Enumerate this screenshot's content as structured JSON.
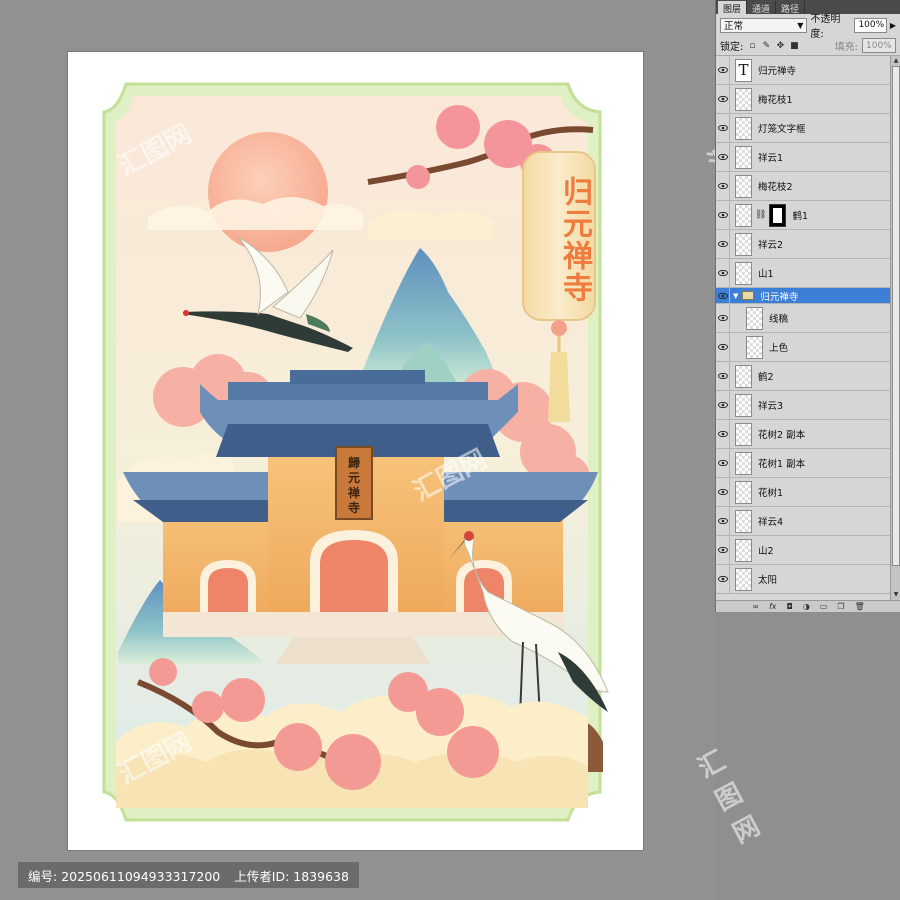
{
  "artwork": {
    "vertical_title": "归元禅寺",
    "gate_plaque": "歸元禅寺",
    "colors": {
      "frame": "#c9e3a3",
      "sky": "#f8ecd5",
      "sun": "#f7b79e",
      "mountain": "#6f9fc2",
      "roof": "#5b7ea8",
      "wall": "#f2b568",
      "door": "#ee7f63",
      "blossom": "#f48f8a",
      "lantern": "#f9e5b2",
      "title_text": "#ef7c3f"
    }
  },
  "watermark": {
    "text": "汇图网"
  },
  "info_bar": {
    "id_label": "编号:",
    "id_value": "20250611094933317200",
    "uploader_label": "上传者ID:",
    "uploader_value": "1839638"
  },
  "layers_panel": {
    "tabs": [
      "图层",
      "通道",
      "路径"
    ],
    "blend_mode": "正常",
    "opacity_label": "不透明度:",
    "opacity_value": "100%",
    "lock_label": "锁定:",
    "fill_label": "填充:",
    "fill_value": "100%",
    "layers": [
      {
        "name": "归元禅寺",
        "kind": "text"
      },
      {
        "name": "梅花枝1",
        "kind": "normal"
      },
      {
        "name": "灯笼文字框",
        "kind": "normal"
      },
      {
        "name": "祥云1",
        "kind": "normal"
      },
      {
        "name": "梅花枝2",
        "kind": "normal"
      },
      {
        "name": "鹤1",
        "kind": "mask"
      },
      {
        "name": "祥云2",
        "kind": "normal"
      },
      {
        "name": "山1",
        "kind": "normal"
      },
      {
        "name": "归元禅寺",
        "kind": "group"
      },
      {
        "name": "线稿",
        "kind": "child"
      },
      {
        "name": "上色",
        "kind": "child"
      },
      {
        "name": "鹤2",
        "kind": "normal"
      },
      {
        "name": "祥云3",
        "kind": "normal"
      },
      {
        "name": "花树2 副本",
        "kind": "normal"
      },
      {
        "name": "花树1 副本",
        "kind": "normal"
      },
      {
        "name": "花树1",
        "kind": "normal"
      },
      {
        "name": "祥云4",
        "kind": "normal"
      },
      {
        "name": "山2",
        "kind": "normal"
      },
      {
        "name": "太阳",
        "kind": "normal"
      }
    ],
    "footer_icons": [
      "link-icon",
      "fx-icon",
      "mask-icon",
      "adjustment-icon",
      "folder-icon",
      "new-layer-icon",
      "trash-icon"
    ]
  }
}
